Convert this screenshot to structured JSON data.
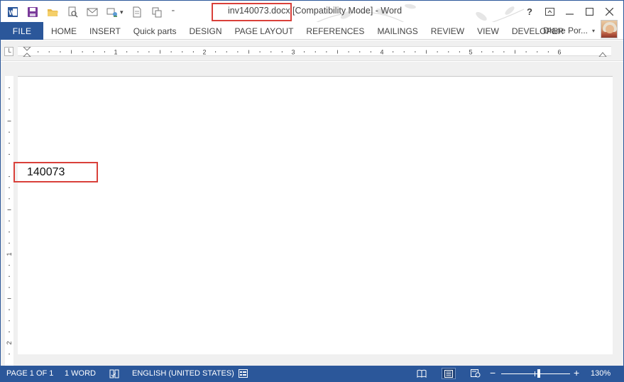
{
  "title_bar": {
    "filename": "inv140073.docx",
    "mode": " [Compatibility Mode] - Word",
    "controls": [
      "?",
      "restore",
      "minimize",
      "maximize",
      "close"
    ]
  },
  "ribbon": {
    "file_tab": "FILE",
    "tabs": [
      "HOME",
      "INSERT",
      "Quick parts",
      "DESIGN",
      "PAGE LAYOUT",
      "REFERENCES",
      "MAILINGS",
      "REVIEW",
      "VIEW",
      "DEVELOPER"
    ],
    "user_name": "Diane Por..."
  },
  "ruler": {
    "h_numbers": [
      "1",
      "2",
      "3",
      "4",
      "5",
      "6"
    ],
    "v_numbers": [
      "1",
      "2"
    ]
  },
  "document": {
    "text": "140073"
  },
  "status_bar": {
    "page": "PAGE 1 OF 1",
    "words": "1 WORD",
    "language": "ENGLISH (UNITED STATES)",
    "zoom": "130%",
    "zoom_minus": "−",
    "zoom_plus": "+"
  },
  "colors": {
    "accent": "#2b579a",
    "highlight_box": "#d9403a"
  },
  "icons": [
    "word-app-icon",
    "save-icon",
    "open-folder-icon",
    "print-preview-icon",
    "email-icon",
    "touch-mode-icon",
    "new-document-icon",
    "customize-qat-icon"
  ]
}
